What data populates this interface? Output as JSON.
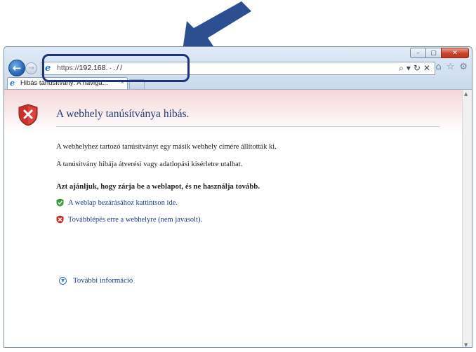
{
  "window": {
    "controls": {
      "minimize": "–",
      "maximize": "▢",
      "close": "✕"
    }
  },
  "nav": {
    "back": "←",
    "forward": "→"
  },
  "address_bar": {
    "protocol": "https://",
    "host": "192.168.",
    "masked_suffix": " · . / /",
    "tools": [
      "⌕",
      "▾",
      "↻",
      "✕"
    ]
  },
  "toolbar_icons": [
    "⌂",
    "☆",
    "⚙"
  ],
  "tab": {
    "label": "Hibás tanúsítvány: A naviga...",
    "close": "×"
  },
  "scrollbar": {
    "up": "▲",
    "down": "▼"
  },
  "page": {
    "title": "A webhely tanúsítványa hibás.",
    "para1": "A webhelyhez tartozó tanúsítványt egy másik webhely címére állították ki.",
    "para2": "A tanúsítvány hibája átverési vagy adatlopási kísérletre utalhat.",
    "recommendation": "Azt ajánljuk, hogy zárja be a weblapot, és ne használja tovább.",
    "link_close": "A weblap bezárásához kattintson ide.",
    "link_continue": "Továbblépés erre a webhelyre (nem javasolt).",
    "more_info": "További információ",
    "more_info_icon": "▼"
  },
  "colors": {
    "callout": "#2b4f91",
    "highlight": "#1d3576",
    "link": "#1a3d8f",
    "title": "#1d3b75",
    "error_red": "#c8322b",
    "success_green": "#3a9a3f"
  }
}
